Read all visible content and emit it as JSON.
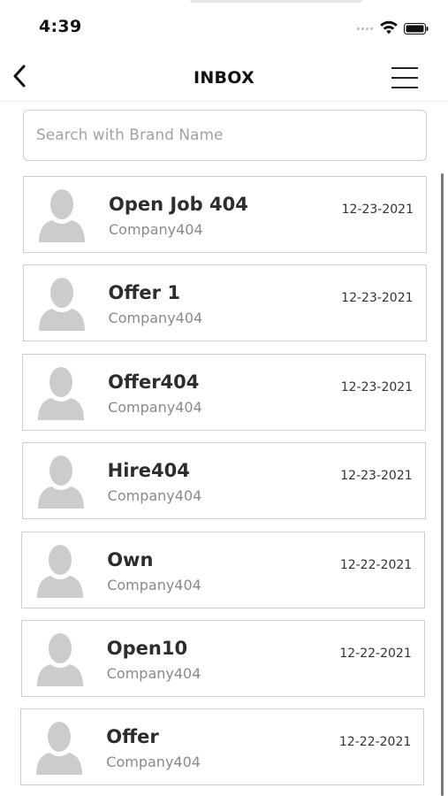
{
  "status_bar": {
    "time": "4:39"
  },
  "header": {
    "title": "INBOX"
  },
  "search": {
    "placeholder": "Search with Brand Name",
    "value": ""
  },
  "messages": [
    {
      "title": "Open Job 404",
      "company": "Company404",
      "date": "12-23-2021"
    },
    {
      "title": "Offer 1",
      "company": "Company404",
      "date": "12-23-2021"
    },
    {
      "title": "Offer404",
      "company": "Company404",
      "date": "12-23-2021"
    },
    {
      "title": "Hire404",
      "company": "Company404",
      "date": "12-23-2021"
    },
    {
      "title": "Own",
      "company": "Company404",
      "date": "12-22-2021"
    },
    {
      "title": "Open10",
      "company": "Company404",
      "date": "12-22-2021"
    },
    {
      "title": "Offer",
      "company": "Company404",
      "date": "12-22-2021"
    }
  ],
  "icons": {
    "back": "chevron-left-icon",
    "menu": "hamburger-menu-icon",
    "avatar": "user-placeholder-icon",
    "wifi": "wifi-icon",
    "battery": "battery-icon"
  },
  "colors": {
    "card_border": "#cfcfcf",
    "avatar": "#cccccc",
    "title": "#2d2d2d",
    "subtitle": "#8a8a8a"
  }
}
